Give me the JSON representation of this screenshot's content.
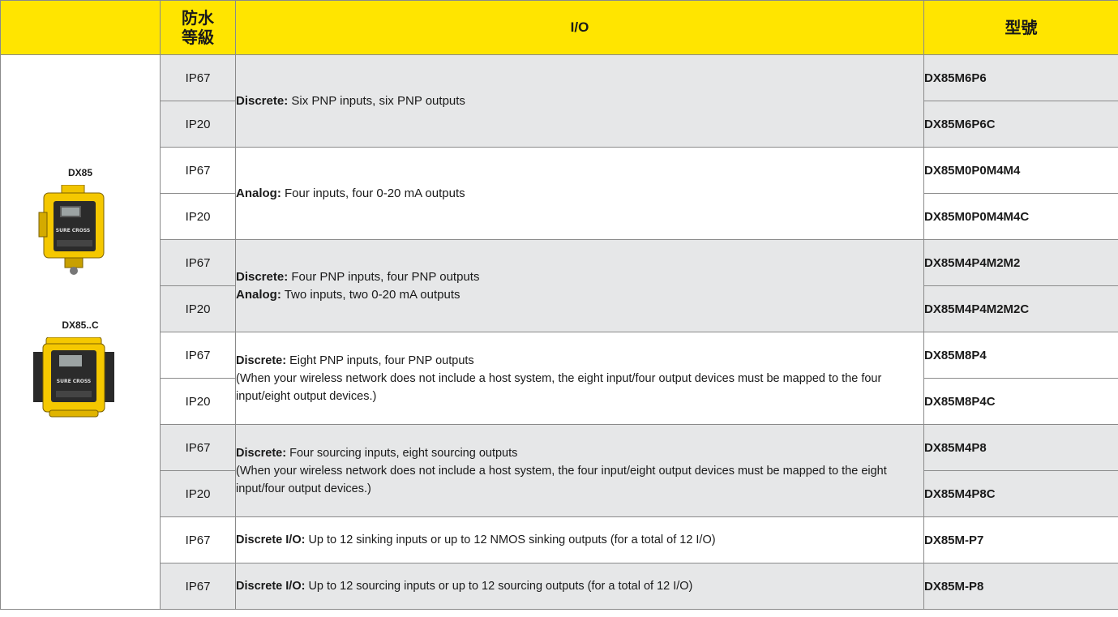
{
  "header": {
    "rating_line1": "防水",
    "rating_line2": "等級",
    "io": "I/O",
    "model": "型號"
  },
  "products": [
    {
      "name": "DX85",
      "image": "dx85-device-image"
    },
    {
      "name": "DX85..C",
      "image": "dx85c-device-image"
    }
  ],
  "rows": [
    {
      "ip": "IP67",
      "model": "DX85M6P6"
    },
    {
      "ip": "IP20",
      "model": "DX85M6P6C"
    },
    {
      "ip": "IP67",
      "model": "DX85M0P0M4M4"
    },
    {
      "ip": "IP20",
      "model": "DX85M0P0M4M4C"
    },
    {
      "ip": "IP67",
      "model": "DX85M4P4M2M2"
    },
    {
      "ip": "IP20",
      "model": "DX85M4P4M2M2C"
    },
    {
      "ip": "IP67",
      "model": "DX85M8P4"
    },
    {
      "ip": "IP20",
      "model": "DX85M8P4C"
    },
    {
      "ip": "IP67",
      "model": "DX85M4P8"
    },
    {
      "ip": "IP20",
      "model": "DX85M4P8C"
    },
    {
      "ip": "IP67",
      "model": "DX85M-P7"
    },
    {
      "ip": "IP67",
      "model": "DX85M-P8"
    }
  ],
  "io": {
    "g1": {
      "label": "Discrete:",
      "text": " Six PNP inputs, six PNP outputs"
    },
    "g2": {
      "label": "Analog:",
      "text": " Four inputs, four 0-20 mA outputs"
    },
    "g3": {
      "label1": "Discrete:",
      "text1": " Four PNP inputs, four PNP outputs",
      "label2": "Analog:",
      "text2": " Two inputs, two 0-20 mA outputs"
    },
    "g4": {
      "label": "Discrete:",
      "text": " Eight PNP inputs, four PNP outputs",
      "note": "(When your wireless network does not include a host system, the eight input/four output devices must be mapped to the four input/eight output devices.)"
    },
    "g5": {
      "label": "Discrete:",
      "text": " Four sourcing inputs, eight sourcing outputs",
      "note": "(When your wireless network does not include a host system, the four input/eight output devices must be mapped to the eight input/four output devices.)"
    },
    "g6": {
      "label": "Discrete I/O:",
      "text": " Up to 12 sinking inputs or up to 12 NMOS sinking outputs (for a total of 12 I/O)"
    },
    "g7": {
      "label": "Discrete I/O:",
      "text": " Up to 12 sourcing inputs or up to 12 sourcing outputs (for a total of 12 I/O)"
    }
  },
  "colors": {
    "header_bg": "#ffe500",
    "shaded_row": "#e6e7e8"
  }
}
